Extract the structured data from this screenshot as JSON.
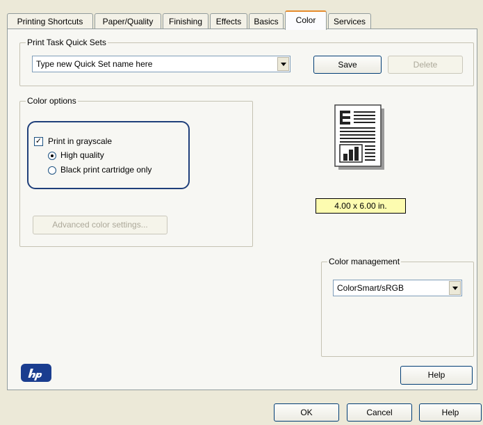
{
  "tabs": [
    {
      "label": "Printing Shortcuts"
    },
    {
      "label": "Paper/Quality"
    },
    {
      "label": "Finishing"
    },
    {
      "label": "Effects"
    },
    {
      "label": "Basics"
    },
    {
      "label": "Color"
    },
    {
      "label": "Services"
    }
  ],
  "active_tab": "Color",
  "quick_sets": {
    "group_title": "Print Task Quick Sets",
    "combo_value": "Type new Quick Set name here",
    "save_label": "Save",
    "delete_label": "Delete"
  },
  "color_options": {
    "group_title": "Color options",
    "grayscale_label": "Print in grayscale",
    "grayscale_checked": true,
    "high_quality_label": "High quality",
    "black_only_label": "Black print cartridge only",
    "selected_radio": "High quality",
    "advanced_label": "Advanced color settings..."
  },
  "preview": {
    "paper_size": "4.00 x 6.00 in."
  },
  "color_management": {
    "group_title": "Color management",
    "value": "ColorSmart/sRGB"
  },
  "help_label": "Help",
  "footer": {
    "ok_label": "OK",
    "cancel_label": "Cancel",
    "help_label": "Help"
  },
  "icons": {
    "logo": "hp-logo",
    "preview": "page-preview-icon"
  },
  "colors": {
    "highlight_ring": "#1f3f7a",
    "paper_size_bg": "#fdfcb0",
    "hp_logo": "#1a3d8f"
  }
}
